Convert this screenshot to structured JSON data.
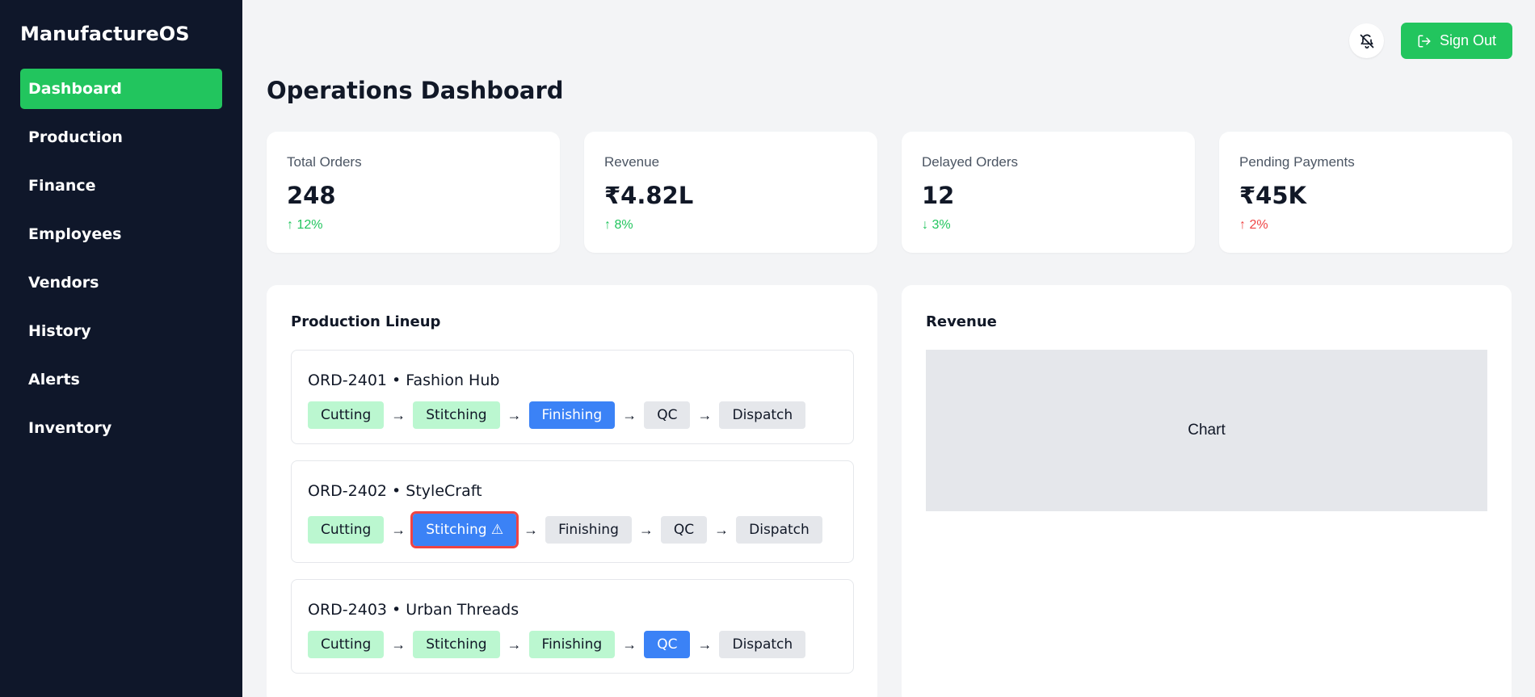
{
  "app": {
    "name": "ManufactureOS"
  },
  "sidebar": {
    "items": [
      {
        "label": "Dashboard",
        "active": true
      },
      {
        "label": "Production"
      },
      {
        "label": "Finance"
      },
      {
        "label": "Employees"
      },
      {
        "label": "Vendors"
      },
      {
        "label": "History"
      },
      {
        "label": "Alerts"
      },
      {
        "label": "Inventory"
      }
    ]
  },
  "header": {
    "icon": "notifications-off-icon",
    "signout_label": "Sign Out"
  },
  "page": {
    "title": "Operations Dashboard"
  },
  "stats": [
    {
      "label": "Total Orders",
      "value": "248",
      "change": "↑ 12%",
      "color": "#22c55e"
    },
    {
      "label": "Revenue",
      "value": "₹4.82L",
      "change": "↑ 8%",
      "color": "#22c55e"
    },
    {
      "label": "Delayed Orders",
      "value": "12",
      "change": "↓ 3%",
      "color": "#22c55e"
    },
    {
      "label": "Pending Payments",
      "value": "₹45K",
      "change": "↑ 2%",
      "color": "#ef4444"
    }
  ],
  "production": {
    "title": "Production Lineup",
    "arrow": "→",
    "orders": [
      {
        "title": "ORD-2401 • Fashion Hub",
        "stages": [
          {
            "label": "Cutting",
            "status": "done"
          },
          {
            "label": "Stitching",
            "status": "done"
          },
          {
            "label": "Finishing",
            "status": "current"
          },
          {
            "label": "QC",
            "status": "pending"
          },
          {
            "label": "Dispatch",
            "status": "pending"
          }
        ]
      },
      {
        "title": "ORD-2402 • StyleCraft",
        "stages": [
          {
            "label": "Cutting",
            "status": "done"
          },
          {
            "label": "Stitching ⚠",
            "status": "current-alert"
          },
          {
            "label": "Finishing",
            "status": "pending"
          },
          {
            "label": "QC",
            "status": "pending"
          },
          {
            "label": "Dispatch",
            "status": "pending"
          }
        ]
      },
      {
        "title": "ORD-2403 • Urban Threads",
        "stages": [
          {
            "label": "Cutting",
            "status": "done"
          },
          {
            "label": "Stitching",
            "status": "done"
          },
          {
            "label": "Finishing",
            "status": "done"
          },
          {
            "label": "QC",
            "status": "current"
          },
          {
            "label": "Dispatch",
            "status": "pending"
          }
        ]
      }
    ]
  },
  "revenue": {
    "title": "Revenue",
    "chart_placeholder": "Chart"
  },
  "colors": {
    "sidebar_bg": "#0f172a",
    "accent": "#22c55e",
    "current_stage": "#3b82f6",
    "done_stage": "#bbf7d0",
    "pending_stage": "#e5e7eb",
    "alert": "#ef4444"
  }
}
